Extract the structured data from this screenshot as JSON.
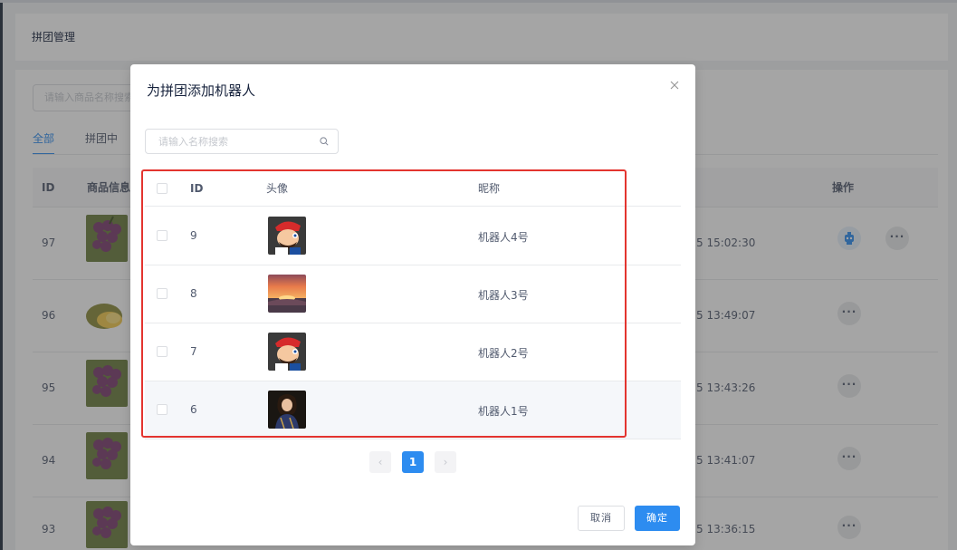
{
  "background": {
    "page_title": "拼团管理",
    "search_placeholder": "请输入商品名称搜索",
    "tabs": [
      {
        "label": "全部",
        "active": true
      },
      {
        "label": "拼团中",
        "active": false
      }
    ],
    "columns": {
      "id": "ID",
      "product": "商品信息",
      "action": "操作"
    },
    "rows": [
      {
        "id": "97",
        "time": "5 15:02:30",
        "thumb": "grape",
        "has_robot": true
      },
      {
        "id": "96",
        "time": "5 13:49:07",
        "thumb": "durian",
        "has_robot": false
      },
      {
        "id": "95",
        "time": "5 13:43:26",
        "thumb": "grape",
        "has_robot": false
      },
      {
        "id": "94",
        "time": "5 13:41:07",
        "thumb": "grape",
        "has_robot": false
      },
      {
        "id": "93",
        "time": "5 13:36:15",
        "thumb": "grape",
        "has_robot": false
      }
    ],
    "more_label": "···"
  },
  "modal": {
    "title": "为拼团添加机器人",
    "search_placeholder": "请输入名称搜索",
    "columns": {
      "id": "ID",
      "avatar": "头像",
      "nickname": "昵称"
    },
    "rows": [
      {
        "id": "9",
        "nickname": "机器人4号",
        "avatar": "mario",
        "checked": false
      },
      {
        "id": "8",
        "nickname": "机器人3号",
        "avatar": "sunset",
        "checked": false
      },
      {
        "id": "7",
        "nickname": "机器人2号",
        "avatar": "mario",
        "checked": false
      },
      {
        "id": "6",
        "nickname": "机器人1号",
        "avatar": "portrait",
        "checked": false
      }
    ],
    "pagination": {
      "prev": "‹",
      "current": "1",
      "next": "›"
    },
    "cancel_label": "取消",
    "ok_label": "确定"
  },
  "colors": {
    "primary": "#2d8cf0",
    "highlight_frame": "#e3342f"
  }
}
